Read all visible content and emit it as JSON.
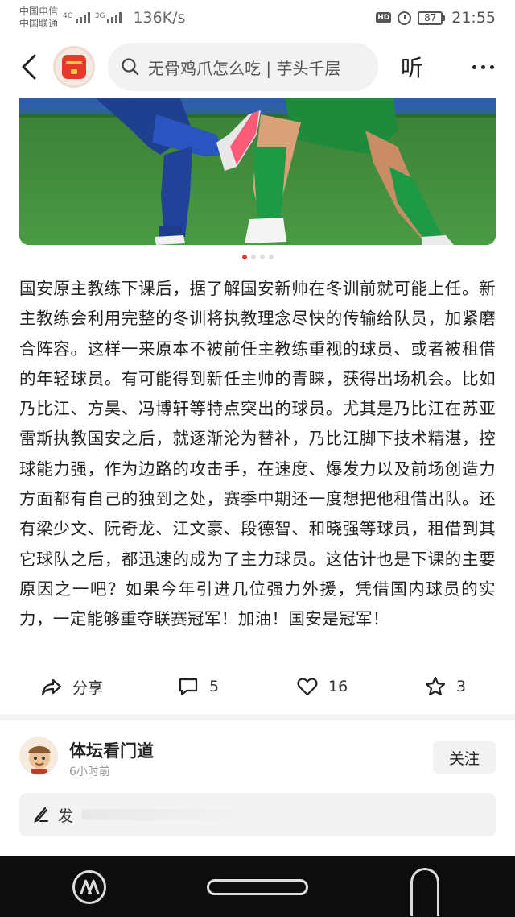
{
  "status_bar": {
    "carrier1": "中国电信",
    "carrier2": "中国联通",
    "sig1_tag": "4G",
    "sig2_tag": "3G",
    "speed": "136K/s",
    "hd": "HD",
    "battery": "87",
    "time": "21:55"
  },
  "nav": {
    "search_placeholder": "无骨鸡爪怎么吃 | 芋头千层",
    "listen_label": "听"
  },
  "carousel": {
    "total": 4,
    "active": 1
  },
  "article": {
    "text": "国安原主教练下课后，据了解国安新帅在冬训前就可能上任。新主教练会利用完整的冬训将执教理念尽快的传输给队员，加紧磨合阵容。这样一来原本不被前任主教练重视的球员、或者被租借的年轻球员。有可能得到新任主帅的青睐，获得出场机会。比如乃比江、方昊、冯博轩等特点突出的球员。尤其是乃比江在苏亚雷斯执教国安之后，就逐渐沦为替补，乃比江脚下技术精湛，控球能力强，作为边路的攻击手，在速度、爆发力以及前场创造力方面都有自己的独到之处，赛季中期还一度想把他租借出队。还有梁少文、阮奇龙、江文豪、段德智、和晓强等球员，租借到其它球队之后，都迅速的成为了主力球员。这估计也是下课的主要原因之一吧？如果今年引进几位强力外援，凭借国内球员的实力，一定能够重夺联赛冠军！加油！国安是冠军！"
  },
  "actions": {
    "share_label": "分享",
    "comment_count": "5",
    "like_count": "16",
    "fav_count": "3"
  },
  "author": {
    "name": "体坛看门道",
    "time": "6小时前",
    "follow_label": "关注"
  },
  "comment_box": {
    "placeholder": "发"
  },
  "colors": {
    "accent": "#e4392c",
    "pitch": "#3d8c3a"
  }
}
